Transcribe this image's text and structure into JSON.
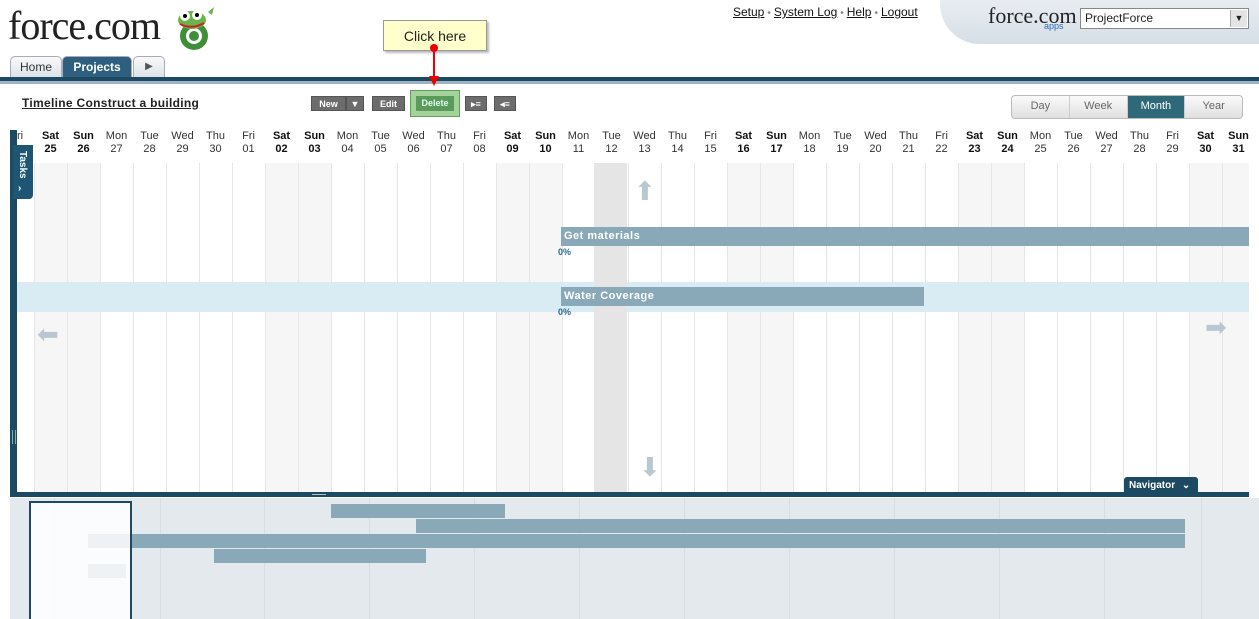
{
  "header": {
    "logo_text": "force.com",
    "links": [
      "Setup",
      "System Log",
      "Help",
      "Logout"
    ],
    "brand_right": "force.com",
    "brand_right_sub": "apps",
    "app_select_value": "ProjectForce"
  },
  "tabs": {
    "home": "Home",
    "projects": "Projects",
    "more": "▶"
  },
  "toolbar": {
    "title": "Timeline Construct a building",
    "new_label": "New",
    "edit_label": "Edit",
    "delete_label": "Delete",
    "callout": "Click here"
  },
  "views": [
    "Day",
    "Week",
    "Month",
    "Year"
  ],
  "active_view": "Month",
  "timeline": {
    "leading_fragment": "ri",
    "days": [
      {
        "dow": "Sat",
        "num": "25",
        "we": true
      },
      {
        "dow": "Sun",
        "num": "26",
        "we": true
      },
      {
        "dow": "Mon",
        "num": "27"
      },
      {
        "dow": "Tue",
        "num": "28"
      },
      {
        "dow": "Wed",
        "num": "29"
      },
      {
        "dow": "Thu",
        "num": "30"
      },
      {
        "dow": "Fri",
        "num": "01"
      },
      {
        "dow": "Sat",
        "num": "02",
        "we": true
      },
      {
        "dow": "Sun",
        "num": "03",
        "we": true
      },
      {
        "dow": "Mon",
        "num": "04"
      },
      {
        "dow": "Tue",
        "num": "05"
      },
      {
        "dow": "Wed",
        "num": "06"
      },
      {
        "dow": "Thu",
        "num": "07"
      },
      {
        "dow": "Fri",
        "num": "08"
      },
      {
        "dow": "Sat",
        "num": "09",
        "we": true
      },
      {
        "dow": "Sun",
        "num": "10",
        "we": true
      },
      {
        "dow": "Mon",
        "num": "11"
      },
      {
        "dow": "Tue",
        "num": "12"
      },
      {
        "dow": "Wed",
        "num": "13"
      },
      {
        "dow": "Thu",
        "num": "14"
      },
      {
        "dow": "Fri",
        "num": "15"
      },
      {
        "dow": "Sat",
        "num": "16",
        "we": true
      },
      {
        "dow": "Sun",
        "num": "17",
        "we": true
      },
      {
        "dow": "Mon",
        "num": "18"
      },
      {
        "dow": "Tue",
        "num": "19"
      },
      {
        "dow": "Wed",
        "num": "20"
      },
      {
        "dow": "Thu",
        "num": "21"
      },
      {
        "dow": "Fri",
        "num": "22"
      },
      {
        "dow": "Sat",
        "num": "23",
        "we": true
      },
      {
        "dow": "Sun",
        "num": "24",
        "we": true
      },
      {
        "dow": "Mon",
        "num": "25"
      },
      {
        "dow": "Tue",
        "num": "26"
      },
      {
        "dow": "Wed",
        "num": "27"
      },
      {
        "dow": "Thu",
        "num": "28"
      },
      {
        "dow": "Fri",
        "num": "29"
      },
      {
        "dow": "Sat",
        "num": "30",
        "we": true
      },
      {
        "dow": "Sun",
        "num": "31",
        "we": true
      }
    ],
    "tasks": [
      {
        "name": "Get materials",
        "progress": "0%"
      },
      {
        "name": "Water Coverage",
        "progress": "0%"
      }
    ],
    "tasks_tab": "Tasks",
    "navigator_label": "Navigator"
  }
}
